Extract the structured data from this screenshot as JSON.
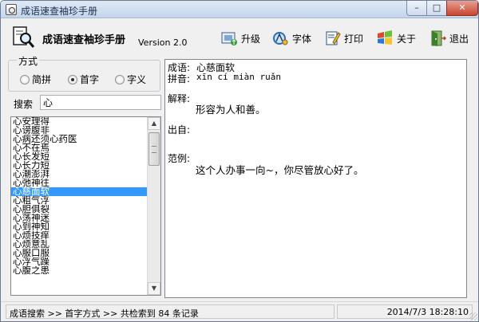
{
  "window": {
    "title": "成语速查袖珍手册",
    "min_glyph": "–",
    "max_glyph": "□",
    "close_glyph": "✕"
  },
  "header": {
    "app_title": "成语速查袖珍手册",
    "version": "Version 2.0"
  },
  "toolbar": {
    "upgrade_label": "升级",
    "font_label": "字体",
    "print_label": "打印",
    "about_label": "关于",
    "exit_label": "退出"
  },
  "mode": {
    "legend": "方式",
    "options": [
      {
        "label": "简拼",
        "selected": false
      },
      {
        "label": "首字",
        "selected": true
      },
      {
        "label": "字义",
        "selected": false
      }
    ]
  },
  "search": {
    "label": "搜索",
    "value": "心"
  },
  "results": {
    "items": [
      "心安理得",
      "心谤腹非",
      "心病还须心药医",
      "心不在焉",
      "心长发短",
      "心长力短",
      "心潮澎湃",
      "心弛神往",
      "心慈面软",
      "心粗气浮",
      "心胆俱裂",
      "心荡神迷",
      "心到神知",
      "心烦技痒",
      "心烦意乱",
      "心服口服",
      "心浮气躁",
      "心腹之患"
    ],
    "selected_index": 8,
    "scroll_up_glyph": "▲",
    "scroll_down_glyph": "▼"
  },
  "detail": {
    "idiom_label": "成语:",
    "idiom": "心慈面软",
    "pinyin_label": "拼音:",
    "pinyin": "xīn  cí  miàn  ruǎn",
    "explain_label": "解释:",
    "explain": "形容为人和善。",
    "source_label": "出自:",
    "source": "",
    "example_label": "范例:",
    "example": "这个人办事一向~，你尽管放心好了。"
  },
  "status": {
    "left": "成语搜索 >> 首字方式 >> 共检索到 84 条记录",
    "right": "2014/7/3 18:28:10"
  }
}
